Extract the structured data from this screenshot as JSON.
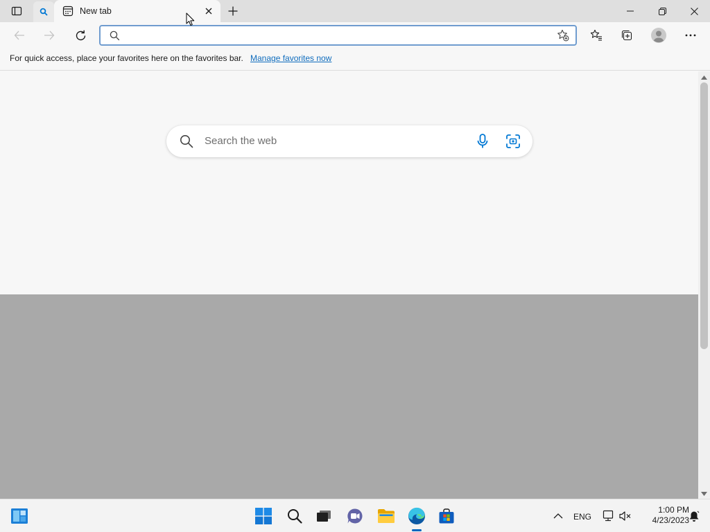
{
  "browser": {
    "tab": {
      "title": "New tab"
    },
    "address_bar": {
      "value": "",
      "placeholder": ""
    }
  },
  "favorites_bar": {
    "message": "For quick access, place your favorites here on the favorites bar.",
    "link": "Manage favorites now"
  },
  "new_tab_page": {
    "search": {
      "placeholder": "Search the web"
    }
  },
  "taskbar": {
    "language": "ENG",
    "time": "1:00 PM",
    "date": "4/23/2023"
  },
  "colors": {
    "accent": "#0067c0",
    "link": "#0f6cbd",
    "bing_blue": "#0078d4"
  }
}
